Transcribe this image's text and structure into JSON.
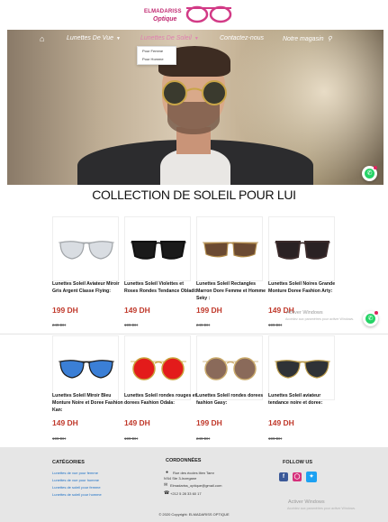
{
  "logo": {
    "line1": "ELMADARISS",
    "line2": "Optique"
  },
  "nav": {
    "items": [
      {
        "label": "Lunettes De Vue",
        "has_caret": true
      },
      {
        "label": "Lunettes De Soleil",
        "has_caret": true
      },
      {
        "label": "Contactez-nous",
        "has_caret": false
      },
      {
        "label": "Notre magasin",
        "has_caret": false
      }
    ],
    "dropdown": [
      "Pour Femme",
      "Pour Homme"
    ]
  },
  "collection_title": "COLLECTION DE SOLEIL POUR LUI",
  "products": [
    {
      "name": "Lunettes Soleil Aviateur Miroir Gris Argent Classe Flying:",
      "price": "199 DH",
      "old_price": "249 DH",
      "lens": "#d9dde2",
      "frame": "#a0a4a8",
      "shape": "aviator"
    },
    {
      "name": "Lunettes Soleil Violettes et Roses Rondes Tendance Obladi:",
      "price": "149 DH",
      "old_price": "199 DH",
      "lens": "#1a1a1a",
      "frame": "#111111",
      "shape": "wayfarer"
    },
    {
      "name": "Lunettes Soleil Rectangles Marron Dore Femme et Homme Seky :",
      "price": "199 DH",
      "old_price": "249 DH",
      "lens": "#6b4a32",
      "frame": "#b08a4a",
      "shape": "rect"
    },
    {
      "name": "Lunettes Soleil Noires Grande Monture Doree Fashion Arty:",
      "price": "149 DH",
      "old_price": "199 DH",
      "lens": "#2a2224",
      "frame": "#3a2a2a",
      "shape": "wayfarer"
    },
    {
      "name": "Lunettes Soleil Miroir Bleu Monture Noire et Doree Fashion Kan:",
      "price": "149 DH",
      "old_price": "199 DH",
      "lens": "#3b7fd6",
      "frame": "#1a1a1a",
      "shape": "aviator"
    },
    {
      "name": "Lunettes Soleil rondes rouges et dorees Fashion Odala:",
      "price": "149 DH",
      "old_price": "199 DH",
      "lens": "#e31b1b",
      "frame": "#c9a03a",
      "shape": "round"
    },
    {
      "name": "Lunettes Soleil rondes dorees fashion Gasy:",
      "price": "199 DH",
      "old_price": "249 DH",
      "lens": "#8a6a5a",
      "frame": "#c9a96a",
      "shape": "round"
    },
    {
      "name": "Lunettes Soleil aviateur tendance noire et doree:",
      "price": "149 DH",
      "old_price": "199 DH",
      "lens": "#2f3236",
      "frame": "#b89848",
      "shape": "aviator"
    }
  ],
  "windows_notice": {
    "title": "Activer Windows",
    "subtitle": "Accédez aux paramètres pour activer Windows."
  },
  "footer": {
    "categories_heading": "CATÉGORIES",
    "categories": [
      "Lunettes de vue pour femme",
      "Lunettes de vue pour homme",
      "Lunettes de soleil pour femme",
      "Lunettes de soleil pour homme"
    ],
    "contact_heading": "CORDONNÉES",
    "address_line1": "Rue des écoles liten Tamr",
    "address_line2": "N'64 Ste 3-Inzegane",
    "email": "Elmadariss_optique@gmail.com",
    "phone": "+212 5 28 33 60 17",
    "follow_heading": "FOLLOW US",
    "copyright": "© 2020 Copyright: ELMADARISS OPTIQUE"
  },
  "colors": {
    "brand": "#c02770",
    "price": "#c0392b",
    "link": "#1a6fc6",
    "nav_active": "#e07fb0"
  },
  "icons": [
    "home-icon",
    "chevron-down-icon",
    "map-pin-icon",
    "whatsapp-icon",
    "facebook-icon",
    "instagram-icon",
    "twitter-icon",
    "location-icon",
    "email-icon",
    "phone-icon"
  ]
}
